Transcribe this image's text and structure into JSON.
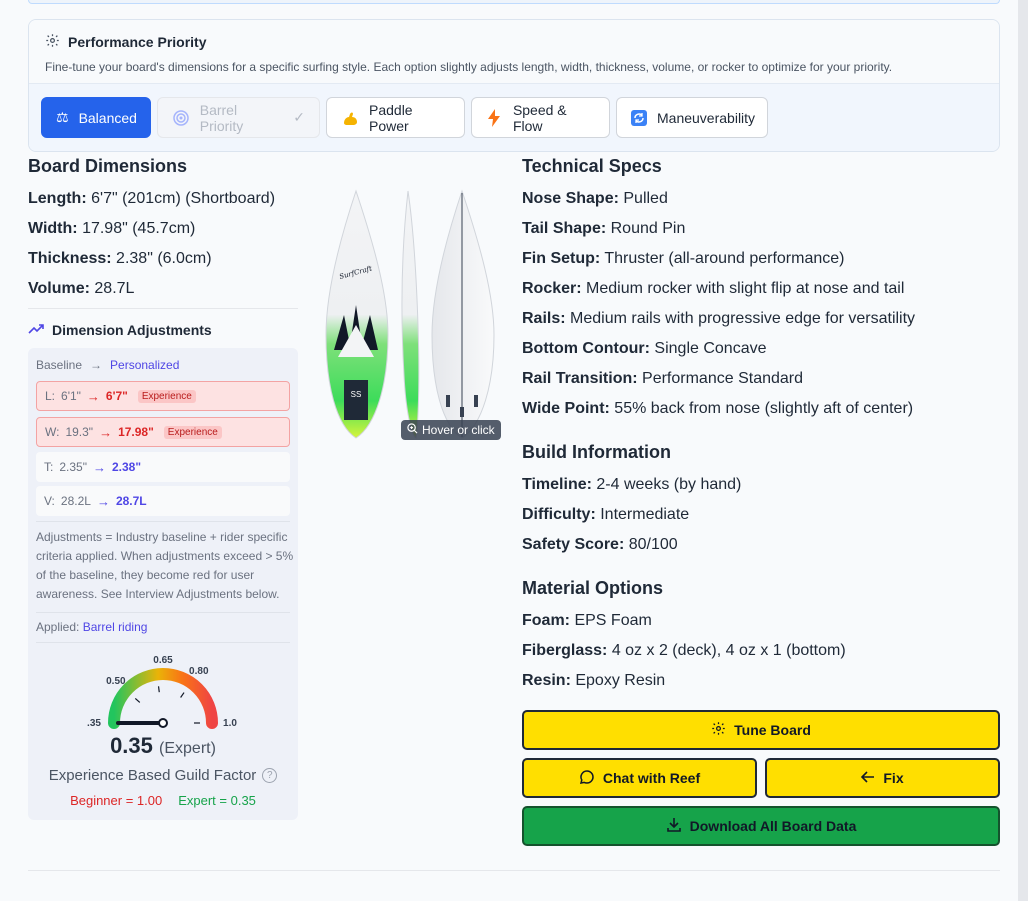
{
  "performance": {
    "title": "Performance Priority",
    "description": "Fine-tune your board's dimensions for a specific surfing style. Each option slightly adjusts length, width, thickness, volume, or rocker to optimize for your priority.",
    "options": [
      {
        "label": "Balanced",
        "icon": "scale-icon",
        "state": "active"
      },
      {
        "label": "Barrel Priority",
        "suffix": "✓",
        "icon": "wave-icon",
        "state": "disabled"
      },
      {
        "label": "Paddle Power",
        "icon": "muscle-icon",
        "state": "normal"
      },
      {
        "label": "Speed & Flow",
        "icon": "lightning-icon",
        "state": "normal"
      },
      {
        "label": "Maneuverability",
        "icon": "refresh-icon",
        "state": "normal"
      }
    ]
  },
  "dimensions": {
    "title": "Board Dimensions",
    "items": [
      {
        "label": "Length:",
        "value": "6'7\" (201cm) (Shortboard)"
      },
      {
        "label": "Width:",
        "value": "17.98\" (45.7cm)"
      },
      {
        "label": "Thickness:",
        "value": "2.38\" (6.0cm)"
      },
      {
        "label": "Volume:",
        "value": "28.7L"
      }
    ]
  },
  "image": {
    "hover_label": "Hover or click",
    "brand": "SurfCraft"
  },
  "adjustments": {
    "title": "Dimension Adjustments",
    "baseline_label": "Baseline",
    "arrow": "→",
    "personalized_label": "Personalized",
    "rows": [
      {
        "key": "L:",
        "from": "6'1\"",
        "to": "6'7\"",
        "badge": "Experience",
        "flag": "red"
      },
      {
        "key": "W:",
        "from": "19.3\"",
        "to": "17.98\"",
        "badge": "Experience",
        "flag": "red"
      },
      {
        "key": "T:",
        "from": "2.35\"",
        "to": "2.38\"",
        "badge": "",
        "flag": "plain"
      },
      {
        "key": "V:",
        "from": "28.2L",
        "to": "28.7L",
        "badge": "",
        "flag": "plain"
      }
    ],
    "note": "Adjustments = Industry baseline + rider specific criteria applied. When adjustments exceed > 5% of the baseline, they become red for user awareness. See Interview Adjustments below.",
    "applied_label": "Applied:",
    "applied_value": "Barrel riding"
  },
  "gauge": {
    "value": 0.35,
    "value_text": "0.35",
    "level_text": "(Expert)",
    "ticks": [
      ".35",
      "0.50",
      "0.65",
      "0.80",
      "1.0"
    ],
    "range": [
      0.35,
      1.0
    ],
    "title": "Experience Based Guild Factor",
    "help": "?",
    "beginner": "Beginner = 1.00",
    "expert": "Expert = 0.35"
  },
  "technical": {
    "title": "Technical Specs",
    "items": [
      {
        "label": "Nose Shape:",
        "value": "Pulled"
      },
      {
        "label": "Tail Shape:",
        "value": "Round Pin"
      },
      {
        "label": "Fin Setup:",
        "value": "Thruster (all-around performance)"
      },
      {
        "label": "Rocker:",
        "value": "Medium rocker with slight flip at nose and tail"
      },
      {
        "label": "Rails:",
        "value": "Medium rails with progressive edge for versatility"
      },
      {
        "label": "Bottom Contour:",
        "value": "Single Concave"
      },
      {
        "label": "Rail Transition:",
        "value": "Performance Standard"
      },
      {
        "label": "Wide Point:",
        "value": "55% back from nose (slightly aft of center)"
      }
    ]
  },
  "build": {
    "title": "Build Information",
    "items": [
      {
        "label": "Timeline:",
        "value": "2-4 weeks (by hand)"
      },
      {
        "label": "Difficulty:",
        "value": "Intermediate"
      },
      {
        "label": "Safety Score:",
        "value": "80/100"
      }
    ]
  },
  "material": {
    "title": "Material Options",
    "items": [
      {
        "label": "Foam:",
        "value": "EPS Foam"
      },
      {
        "label": "Fiberglass:",
        "value": "4 oz x 2 (deck), 4 oz x 1 (bottom)"
      },
      {
        "label": "Resin:",
        "value": "Epoxy Resin"
      }
    ]
  },
  "actions": {
    "tune": "Tune Board",
    "chat": "Chat with Reef",
    "fix": "Fix",
    "download": "Download All Board Data"
  },
  "colors": {
    "accent": "#2563eb",
    "action_yellow": "#ffdf00",
    "action_green": "#16a34a",
    "warning_red": "#dc2626",
    "personal_indigo": "#4f46e5"
  }
}
